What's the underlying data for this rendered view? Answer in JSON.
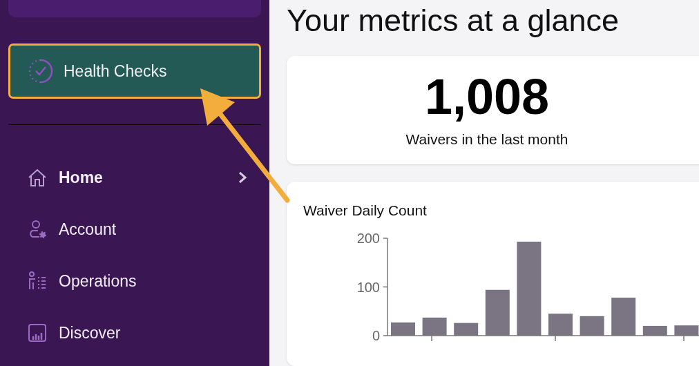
{
  "sidebar": {
    "highlight_button": {
      "label": "Health Checks"
    },
    "items": [
      {
        "label": "Home",
        "kind": "home",
        "selected": true,
        "expandable": true
      },
      {
        "label": "Account",
        "kind": "account",
        "selected": false,
        "expandable": false
      },
      {
        "label": "Operations",
        "kind": "operations",
        "selected": false,
        "expandable": false
      },
      {
        "label": "Discover",
        "kind": "discover",
        "selected": false,
        "expandable": false
      }
    ]
  },
  "main": {
    "title": "Your metrics at a glance",
    "stat": {
      "value": "1,008",
      "label": "Waivers in the last month"
    },
    "chart_card": {
      "title": "Waiver Daily Count",
      "chart_data": {
        "type": "bar",
        "values": [
          27,
          37,
          26,
          94,
          193,
          45,
          40,
          78,
          20,
          21
        ],
        "ylim": [
          0,
          200
        ],
        "yticks": [
          0,
          100,
          200
        ]
      }
    }
  }
}
